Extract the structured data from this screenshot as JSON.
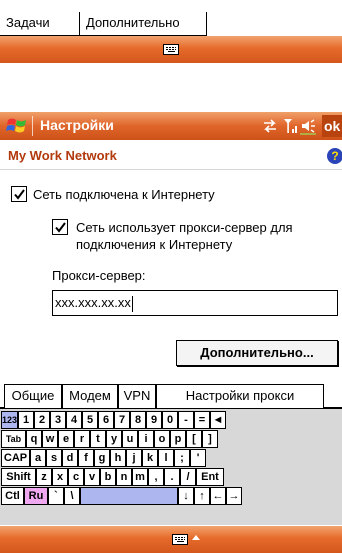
{
  "top_tabs": [
    "Задачи",
    "Дополнительно"
  ],
  "title_bar": {
    "title": "Настройки",
    "ok_label": "ok"
  },
  "header": {
    "title": "My Work Network",
    "help_glyph": "?"
  },
  "checkboxes": [
    {
      "label": "Сеть подключена к Интернету",
      "checked": true
    },
    {
      "label_line1": "Сеть использует прокси-сервер для",
      "label_line2": "подключения к Интернету",
      "checked": true
    }
  ],
  "proxy": {
    "label": "Прокси-сервер:",
    "value": "xxx.xxx.xx.xx"
  },
  "advanced_button": "Дополнительно...",
  "bottom_tabs": [
    "Общие",
    "Модем",
    "VPN",
    "Настройки прокси"
  ],
  "keyboard": {
    "row1": [
      "123",
      "1",
      "2",
      "3",
      "4",
      "5",
      "6",
      "7",
      "8",
      "9",
      "0",
      "-",
      "=",
      "◄"
    ],
    "row2": [
      "Tab",
      "q",
      "w",
      "e",
      "r",
      "t",
      "y",
      "u",
      "i",
      "o",
      "p",
      "[",
      "]"
    ],
    "row3": [
      "CAP",
      "a",
      "s",
      "d",
      "f",
      "g",
      "h",
      "j",
      "k",
      "l",
      ";",
      "'"
    ],
    "row4": [
      "Shift",
      "z",
      "x",
      "c",
      "v",
      "b",
      "n",
      "m",
      ",",
      ".",
      "/",
      "Ent"
    ],
    "row5": [
      "Ctl",
      "Ru",
      "`",
      "\\",
      "",
      "↓",
      "↑",
      "←",
      "→"
    ]
  },
  "colors": {
    "accent_orange": "#e0652a",
    "header_text": "#b23a0c",
    "key_pink": "#f0a8f0",
    "key_blue": "#aeb6f0"
  },
  "icons": [
    "windows-start-icon",
    "connectivity-icon",
    "signal-icon",
    "volume-icon",
    "help-icon",
    "keyboard-icon",
    "sip-arrow-up-icon"
  ]
}
